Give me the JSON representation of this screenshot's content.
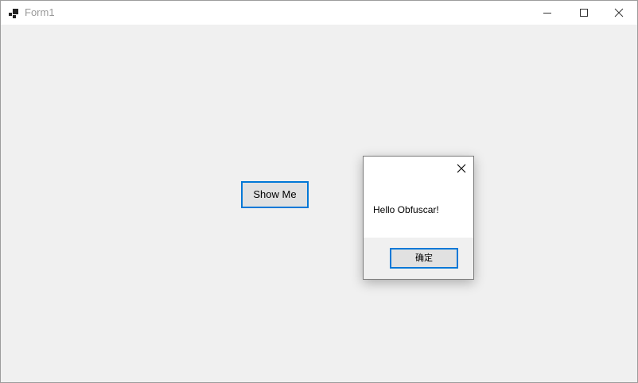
{
  "window": {
    "title": "Form1",
    "icon": "app-window-icon",
    "controls": [
      "minimize-icon",
      "maximize-icon",
      "close-icon"
    ]
  },
  "form": {
    "show_button_label": "Show Me"
  },
  "message_box": {
    "message": "Hello Obfuscar!",
    "ok_label": "确定"
  },
  "colors": {
    "accent": "#0078d7",
    "form_background": "#f0f0f0",
    "titlebar": "#ffffff",
    "title_text": "#999999"
  }
}
